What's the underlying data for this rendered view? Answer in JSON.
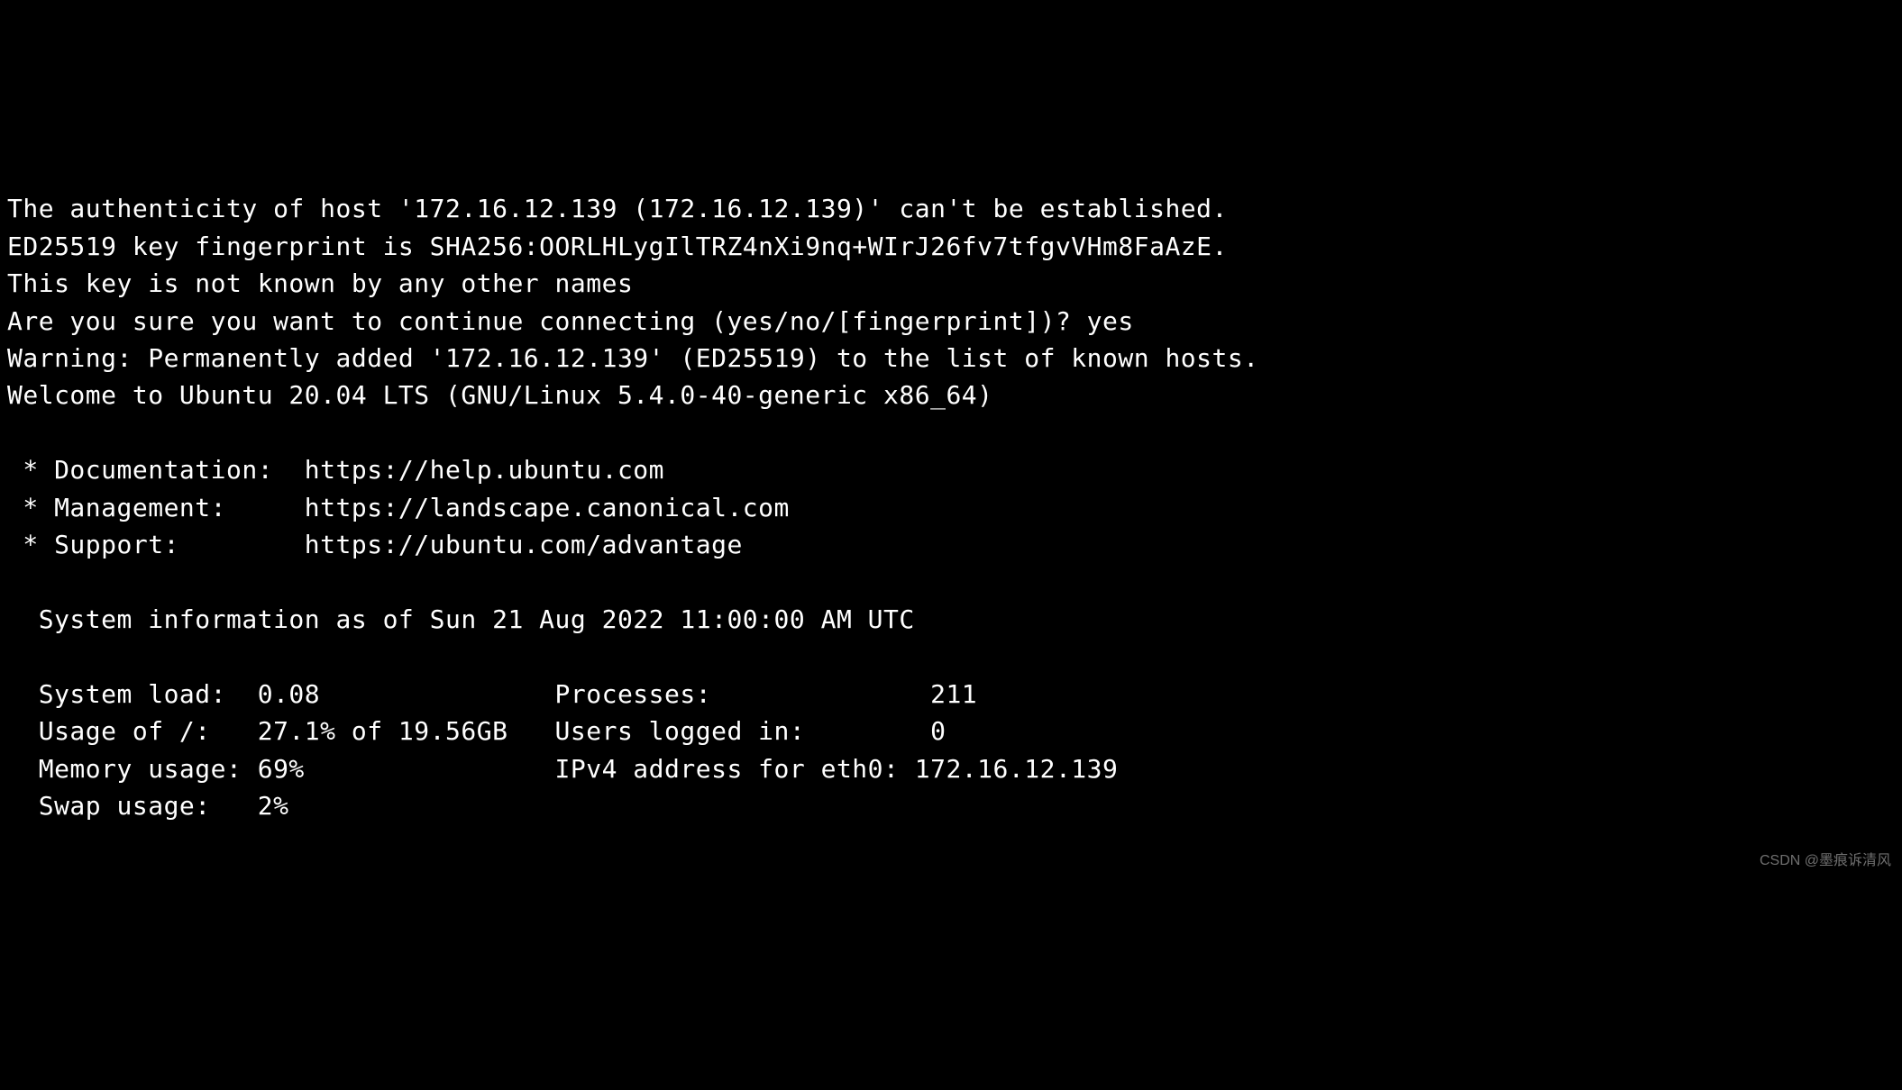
{
  "terminal": {
    "line1": "The authenticity of host '172.16.12.139 (172.16.12.139)' can't be established.",
    "line2": "ED25519 key fingerprint is SHA256:OORLHLygIlTRZ4nXi9nq+WIrJ26fv7tfgvVHm8FaAzE.",
    "line3": "This key is not known by any other names",
    "line4": "Are you sure you want to continue connecting (yes/no/[fingerprint])? yes",
    "line5": "Warning: Permanently added '172.16.12.139' (ED25519) to the list of known hosts.",
    "line6": "Welcome to Ubuntu 20.04 LTS (GNU/Linux 5.4.0-40-generic x86_64)",
    "line7": "",
    "line8": " * Documentation:  https://help.ubuntu.com",
    "line9": " * Management:     https://landscape.canonical.com",
    "line10": " * Support:        https://ubuntu.com/advantage",
    "line11": "",
    "line12": "  System information as of Sun 21 Aug 2022 11:00:00 AM UTC",
    "line13": "",
    "line14": "  System load:  0.08               Processes:              211",
    "line15": "  Usage of /:   27.1% of 19.56GB   Users logged in:        0",
    "line16": "  Memory usage: 69%                IPv4 address for eth0: 172.16.12.139",
    "line17": "  Swap usage:   2%"
  },
  "watermark": "CSDN @墨痕诉清风"
}
